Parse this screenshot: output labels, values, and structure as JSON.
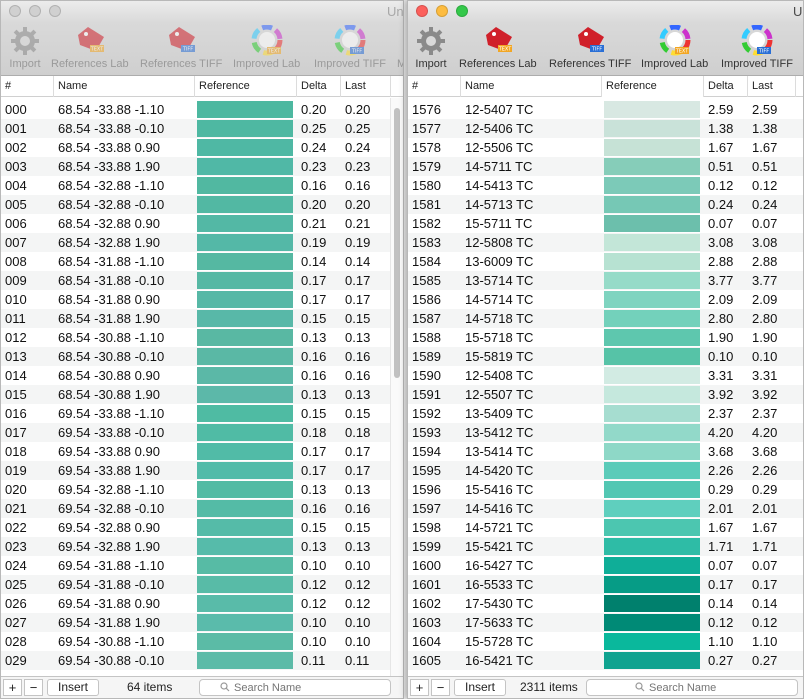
{
  "left": {
    "title": "Unt",
    "toolbar": [
      "Import",
      "References Lab",
      "References TIFF",
      "Improved Lab",
      "Improved TIFF",
      "M"
    ],
    "columns": [
      "#",
      "Name",
      "Reference",
      "Delta",
      "Last"
    ],
    "rows": [
      {
        "id": "000",
        "name": "68.54 -33.88 -1.10",
        "color": "#4db8a0",
        "delta": "0.20",
        "last": "0.20"
      },
      {
        "id": "001",
        "name": "68.54 -33.88 -0.10",
        "color": "#4eb8a2",
        "delta": "0.25",
        "last": "0.25"
      },
      {
        "id": "002",
        "name": "68.54 -33.88 0.90",
        "color": "#4fb8a4",
        "delta": "0.24",
        "last": "0.24"
      },
      {
        "id": "003",
        "name": "68.54 -33.88 1.90",
        "color": "#50b8a6",
        "delta": "0.23",
        "last": "0.23"
      },
      {
        "id": "004",
        "name": "68.54 -32.88 -1.10",
        "color": "#51b8a1",
        "delta": "0.16",
        "last": "0.16"
      },
      {
        "id": "005",
        "name": "68.54 -32.88 -0.10",
        "color": "#52b8a3",
        "delta": "0.20",
        "last": "0.20"
      },
      {
        "id": "006",
        "name": "68.54 -32.88 0.90",
        "color": "#53b8a5",
        "delta": "0.21",
        "last": "0.21"
      },
      {
        "id": "007",
        "name": "68.54 -32.88 1.90",
        "color": "#54b8a7",
        "delta": "0.19",
        "last": "0.19"
      },
      {
        "id": "008",
        "name": "68.54 -31.88 -1.10",
        "color": "#55b8a2",
        "delta": "0.14",
        "last": "0.14"
      },
      {
        "id": "009",
        "name": "68.54 -31.88 -0.10",
        "color": "#56b8a4",
        "delta": "0.17",
        "last": "0.17"
      },
      {
        "id": "010",
        "name": "68.54 -31.88 0.90",
        "color": "#57b8a6",
        "delta": "0.17",
        "last": "0.17"
      },
      {
        "id": "011",
        "name": "68.54 -31.88 1.90",
        "color": "#58b8a8",
        "delta": "0.15",
        "last": "0.15"
      },
      {
        "id": "012",
        "name": "68.54 -30.88 -1.10",
        "color": "#59b8a3",
        "delta": "0.13",
        "last": "0.13"
      },
      {
        "id": "013",
        "name": "68.54 -30.88 -0.10",
        "color": "#5ab8a5",
        "delta": "0.16",
        "last": "0.16"
      },
      {
        "id": "014",
        "name": "68.54 -30.88 0.90",
        "color": "#5bb8a7",
        "delta": "0.16",
        "last": "0.16"
      },
      {
        "id": "015",
        "name": "68.54 -30.88 1.90",
        "color": "#5cb8a9",
        "delta": "0.13",
        "last": "0.13"
      },
      {
        "id": "016",
        "name": "69.54 -33.88 -1.10",
        "color": "#4fbba3",
        "delta": "0.15",
        "last": "0.15"
      },
      {
        "id": "017",
        "name": "69.54 -33.88 -0.10",
        "color": "#50bba5",
        "delta": "0.18",
        "last": "0.18"
      },
      {
        "id": "018",
        "name": "69.54 -33.88 0.90",
        "color": "#51bba7",
        "delta": "0.17",
        "last": "0.17"
      },
      {
        "id": "019",
        "name": "69.54 -33.88 1.90",
        "color": "#52bba9",
        "delta": "0.17",
        "last": "0.17"
      },
      {
        "id": "020",
        "name": "69.54 -32.88 -1.10",
        "color": "#53bba4",
        "delta": "0.13",
        "last": "0.13"
      },
      {
        "id": "021",
        "name": "69.54 -32.88 -0.10",
        "color": "#54bba6",
        "delta": "0.16",
        "last": "0.16"
      },
      {
        "id": "022",
        "name": "69.54 -32.88 0.90",
        "color": "#55bba8",
        "delta": "0.15",
        "last": "0.15"
      },
      {
        "id": "023",
        "name": "69.54 -32.88 1.90",
        "color": "#56bbaa",
        "delta": "0.13",
        "last": "0.13"
      },
      {
        "id": "024",
        "name": "69.54 -31.88 -1.10",
        "color": "#57bba5",
        "delta": "0.10",
        "last": "0.10"
      },
      {
        "id": "025",
        "name": "69.54 -31.88 -0.10",
        "color": "#58bba7",
        "delta": "0.12",
        "last": "0.12"
      },
      {
        "id": "026",
        "name": "69.54 -31.88 0.90",
        "color": "#59bba9",
        "delta": "0.12",
        "last": "0.12"
      },
      {
        "id": "027",
        "name": "69.54 -31.88 1.90",
        "color": "#5abbab",
        "delta": "0.10",
        "last": "0.10"
      },
      {
        "id": "028",
        "name": "69.54 -30.88 -1.10",
        "color": "#5bbba6",
        "delta": "0.10",
        "last": "0.10"
      },
      {
        "id": "029",
        "name": "69.54 -30.88 -0.10",
        "color": "#5cbba8",
        "delta": "0.11",
        "last": "0.11"
      }
    ],
    "bottom": {
      "add": "+",
      "remove": "−",
      "insert": "Insert",
      "count": "64 items",
      "search_placeholder": "Search Name"
    }
  },
  "right": {
    "title": "U",
    "toolbar": [
      "Import",
      "References Lab",
      "References TIFF",
      "Improved Lab",
      "Improved TIFF"
    ],
    "columns": [
      "#",
      "Name",
      "Reference",
      "Delta",
      "Last"
    ],
    "rows": [
      {
        "id": "1576",
        "name": "12-5407 TC",
        "color": "#d8e8e2",
        "delta": "2.59",
        "last": "2.59"
      },
      {
        "id": "1577",
        "name": "12-5406 TC",
        "color": "#c9e2d9",
        "delta": "1.38",
        "last": "1.38"
      },
      {
        "id": "1578",
        "name": "12-5506 TC",
        "color": "#c6e2d6",
        "delta": "1.67",
        "last": "1.67"
      },
      {
        "id": "1579",
        "name": "14-5711 TC",
        "color": "#86cdb9",
        "delta": "0.51",
        "last": "0.51"
      },
      {
        "id": "1580",
        "name": "14-5413 TC",
        "color": "#7ccab8",
        "delta": "0.12",
        "last": "0.12"
      },
      {
        "id": "1581",
        "name": "14-5713 TC",
        "color": "#76c8b5",
        "delta": "0.24",
        "last": "0.24"
      },
      {
        "id": "1582",
        "name": "15-5711 TC",
        "color": "#6cbfac",
        "delta": "0.07",
        "last": "0.07"
      },
      {
        "id": "1583",
        "name": "12-5808 TC",
        "color": "#c3e6d8",
        "delta": "3.08",
        "last": "3.08"
      },
      {
        "id": "1584",
        "name": "13-6009 TC",
        "color": "#b7e2d2",
        "delta": "2.88",
        "last": "2.88"
      },
      {
        "id": "1585",
        "name": "13-5714 TC",
        "color": "#96dbc8",
        "delta": "3.77",
        "last": "3.77"
      },
      {
        "id": "1586",
        "name": "14-5714 TC",
        "color": "#7fd4c0",
        "delta": "2.09",
        "last": "2.09"
      },
      {
        "id": "1587",
        "name": "14-5718 TC",
        "color": "#73d1bb",
        "delta": "2.80",
        "last": "2.80"
      },
      {
        "id": "1588",
        "name": "15-5718 TC",
        "color": "#5ec7ae",
        "delta": "1.90",
        "last": "1.90"
      },
      {
        "id": "1589",
        "name": "15-5819 TC",
        "color": "#56c3a7",
        "delta": "0.10",
        "last": "0.10"
      },
      {
        "id": "1590",
        "name": "12-5408 TC",
        "color": "#d2ebe3",
        "delta": "3.31",
        "last": "3.31"
      },
      {
        "id": "1591",
        "name": "12-5507 TC",
        "color": "#c5e8dd",
        "delta": "3.92",
        "last": "3.92"
      },
      {
        "id": "1592",
        "name": "13-5409 TC",
        "color": "#a6ddd0",
        "delta": "2.37",
        "last": "2.37"
      },
      {
        "id": "1593",
        "name": "13-5412 TC",
        "color": "#92d9c9",
        "delta": "4.20",
        "last": "4.20"
      },
      {
        "id": "1594",
        "name": "13-5414 TC",
        "color": "#8ed8c7",
        "delta": "3.68",
        "last": "3.68"
      },
      {
        "id": "1595",
        "name": "14-5420 TC",
        "color": "#5bcbb9",
        "delta": "2.26",
        "last": "2.26"
      },
      {
        "id": "1596",
        "name": "15-5416 TC",
        "color": "#53c7b3",
        "delta": "0.29",
        "last": "0.29"
      },
      {
        "id": "1597",
        "name": "14-5416 TC",
        "color": "#5fcfbe",
        "delta": "2.01",
        "last": "2.01"
      },
      {
        "id": "1598",
        "name": "14-5721 TC",
        "color": "#4cc6b0",
        "delta": "1.67",
        "last": "1.67"
      },
      {
        "id": "1599",
        "name": "15-5421 TC",
        "color": "#2ebca6",
        "delta": "1.71",
        "last": "1.71"
      },
      {
        "id": "1600",
        "name": "16-5427 TC",
        "color": "#0fae98",
        "delta": "0.07",
        "last": "0.07"
      },
      {
        "id": "1601",
        "name": "16-5533 TC",
        "color": "#069c86",
        "delta": "0.17",
        "last": "0.17"
      },
      {
        "id": "1602",
        "name": "17-5430 TC",
        "color": "#00806d",
        "delta": "0.14",
        "last": "0.14"
      },
      {
        "id": "1603",
        "name": "17-5633 TC",
        "color": "#008a76",
        "delta": "0.12",
        "last": "0.12"
      },
      {
        "id": "1604",
        "name": "15-5728 TC",
        "color": "#0ab89c",
        "delta": "1.10",
        "last": "1.10"
      },
      {
        "id": "1605",
        "name": "16-5421 TC",
        "color": "#10a390",
        "delta": "0.27",
        "last": "0.27"
      }
    ],
    "bottom": {
      "add": "+",
      "remove": "−",
      "insert": "Insert",
      "count": "2311 items",
      "search_placeholder": "Search Name"
    }
  },
  "colors": {
    "accent_swatch": "#4db8a0",
    "alt_row": "#f4f5f5"
  },
  "icons": [
    "gear-icon",
    "tag-text-icon",
    "tag-tiff-icon",
    "color-wheel-text-icon",
    "color-wheel-tiff-icon",
    "magnifier-icon"
  ]
}
